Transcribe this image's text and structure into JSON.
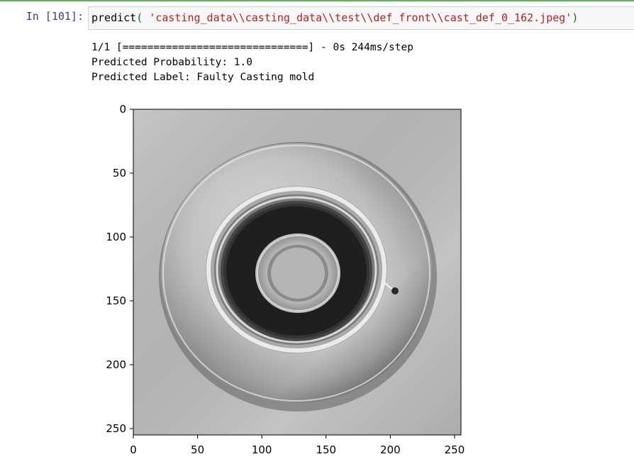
{
  "cell": {
    "prompt": "In [101]:",
    "code": {
      "func": "predict",
      "open_paren": "(",
      "argument": " 'casting_data\\\\casting_data\\\\test\\\\def_front\\\\cast_def_0_162.jpeg'",
      "close_paren": ")"
    }
  },
  "output": {
    "progress_line": "1/1 [==============================] - 0s 244ms/step",
    "probability_line": "Predicted Probability: 1.0",
    "label_line": "Predicted Label: Faulty Casting mold"
  },
  "chart_data": {
    "type": "image",
    "title": "",
    "xlabel": "",
    "ylabel": "",
    "xlim": [
      0,
      255
    ],
    "ylim": [
      255,
      0
    ],
    "xticks": [
      "0",
      "50",
      "100",
      "150",
      "200",
      "250"
    ],
    "yticks": [
      "0",
      "50",
      "100",
      "150",
      "200",
      "250"
    ],
    "x_tick_values": [
      0,
      50,
      100,
      150,
      200,
      250
    ],
    "y_tick_values": [
      0,
      50,
      100,
      150,
      200,
      250
    ],
    "grid": false,
    "colormap": "gray"
  }
}
